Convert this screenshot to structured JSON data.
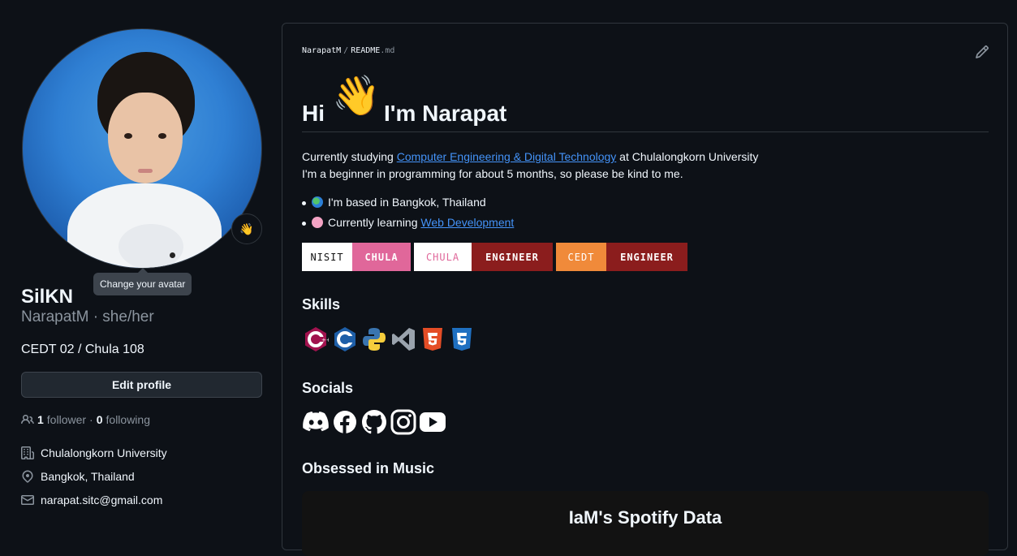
{
  "profile": {
    "avatar_tooltip": "Change your avatar",
    "status_emoji": "👋",
    "name": "SilKN",
    "login_pronouns": "NarapatM · she/her",
    "bio": "CEDT 02 / Chula 108",
    "edit_label": "Edit profile",
    "followers_count": "1",
    "followers_label": "follower",
    "separator": "·",
    "following_count": "0",
    "following_label": "following",
    "organization": "Chulalongkorn University",
    "location": "Bangkok, Thailand",
    "email": "narapat.sitc@gmail.com"
  },
  "readme": {
    "owner": "NarapatM",
    "slash": "/",
    "file": "README",
    "ext": ".md",
    "heading_hi": "Hi",
    "heading_wave": "👋",
    "heading_name": "I'm Narapat",
    "line1_prefix": "Currently studying ",
    "line1_link": "Computer Engineering & Digital Technology",
    "line1_suffix": " at Chulalongkorn University",
    "line2": "I'm a beginner in programming for about 5 months, so please be kind to me.",
    "bullet1": "I'm based in Bangkok, Thailand",
    "bullet2_prefix": "Currently learning ",
    "bullet2_link": "Web Development",
    "badges": [
      {
        "left": "NISIT",
        "right": "CHULA",
        "left_bg": "#ffffff",
        "left_fg": "#111111",
        "right_bg": "#e0679a",
        "right_fg": "#ffffff"
      },
      {
        "left": "CHULA",
        "right": "ENGINEER",
        "left_bg": "#ffffff",
        "left_fg": "#e0679a",
        "right_bg": "#8b1d1d",
        "right_fg": "#ffffff"
      },
      {
        "left": "CEDT",
        "right": "ENGINEER",
        "left_bg": "#f08a3a",
        "left_fg": "#ffffff",
        "right_bg": "#8b1d1d",
        "right_fg": "#ffffff"
      }
    ],
    "skills_title": "Skills",
    "skills_icons": [
      "cplusplus-icon",
      "c-icon",
      "python-icon",
      "vscode-icon",
      "html5-icon",
      "css3-icon"
    ],
    "socials_title": "Socials",
    "social_icons": [
      "discord-icon",
      "facebook-icon",
      "github-icon",
      "instagram-icon",
      "youtube-icon"
    ],
    "music_title": "Obsessed in Music",
    "spotify_title": "IaM's Spotify Data"
  },
  "colors": {
    "background": "#0d1117",
    "link": "#4493f8",
    "border": "#30363d"
  }
}
